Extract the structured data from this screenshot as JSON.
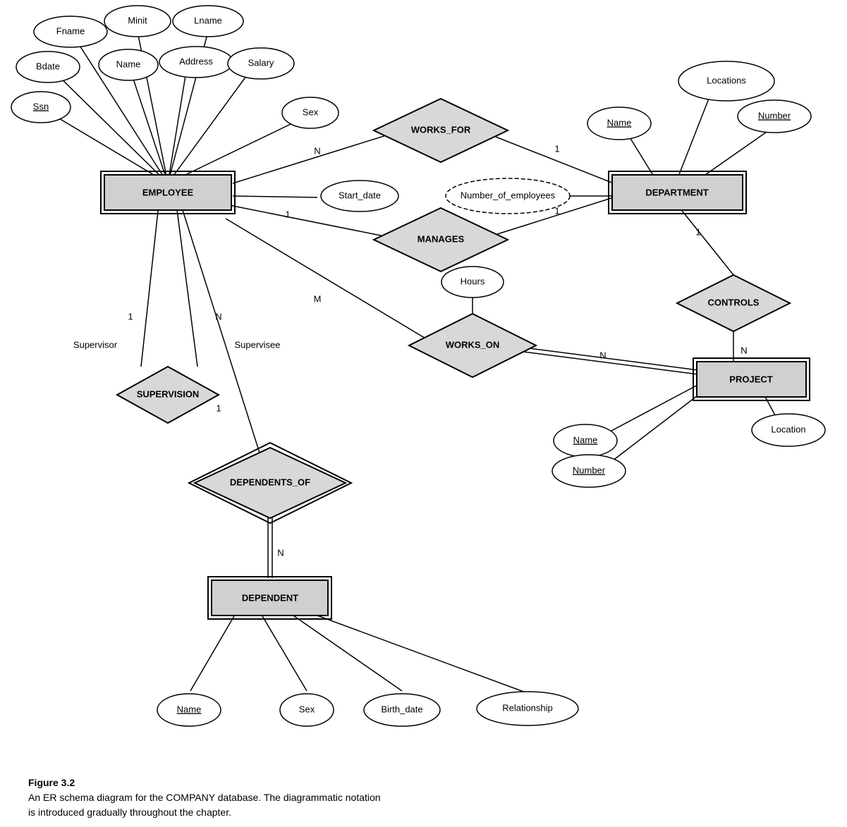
{
  "caption": {
    "title": "Figure 3.2",
    "line1": "An ER schema diagram for the COMPANY database. The diagrammatic notation",
    "line2": "is introduced gradually throughout the chapter."
  },
  "entities": {
    "employee": "EMPLOYEE",
    "department": "DEPARTMENT",
    "project": "PROJECT",
    "dependent": "DEPENDENT"
  },
  "relationships": {
    "works_for": "WORKS_FOR",
    "manages": "MANAGES",
    "works_on": "WORKS_ON",
    "controls": "CONTROLS",
    "supervision": "SUPERVISION",
    "dependents_of": "DEPENDENTS_OF"
  },
  "attributes": {
    "fname": "Fname",
    "minit": "Minit",
    "lname": "Lname",
    "bdate": "Bdate",
    "name_emp": "Name",
    "address": "Address",
    "salary": "Salary",
    "ssn": "Ssn",
    "sex_emp": "Sex",
    "start_date": "Start_date",
    "number_of_employees": "Number_of_employees",
    "locations": "Locations",
    "dept_name": "Name",
    "dept_number": "Number",
    "hours": "Hours",
    "proj_name": "Name",
    "proj_number": "Number",
    "location": "Location",
    "dep_name": "Name",
    "dep_sex": "Sex",
    "birth_date": "Birth_date",
    "relationship": "Relationship"
  },
  "cardinalities": {
    "n1": "N",
    "one1": "1",
    "n2": "N",
    "one2": "1",
    "m1": "M",
    "n3": "N",
    "one3": "1",
    "n4": "N",
    "one4": "1",
    "n5": "N",
    "one5": "1",
    "supervisor": "Supervisor",
    "supervisee": "Supervisee"
  }
}
